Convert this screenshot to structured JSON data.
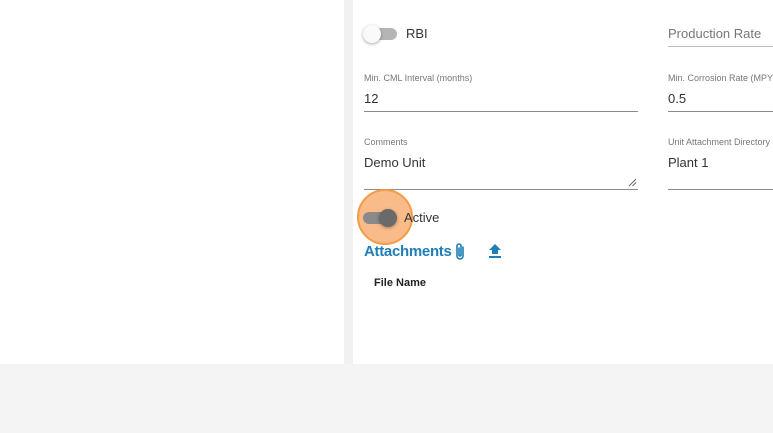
{
  "form": {
    "rbi_toggle": {
      "label": "RBI",
      "checked": false
    },
    "production_rate": {
      "placeholder": "Production Rate",
      "value": ""
    },
    "min_cml_interval": {
      "label": "Min. CML Interval (months)",
      "value": "12"
    },
    "min_corrosion_rate": {
      "label": "Min. Corrosion Rate (MPY)",
      "value": "0.5"
    },
    "comments": {
      "label": "Comments",
      "value": "Demo Unit"
    },
    "unit_attachment_directory": {
      "label": "Unit Attachment Directory",
      "value": "Plant 1"
    },
    "active_toggle": {
      "label": "Active",
      "checked": true
    }
  },
  "attachments": {
    "heading": "Attachments",
    "attach_icon": "paperclip-icon",
    "upload_icon": "upload-icon",
    "columns": [
      "File Name"
    ]
  },
  "colors": {
    "accent": "#1f7eb6",
    "click_highlight": "#f59b47"
  }
}
